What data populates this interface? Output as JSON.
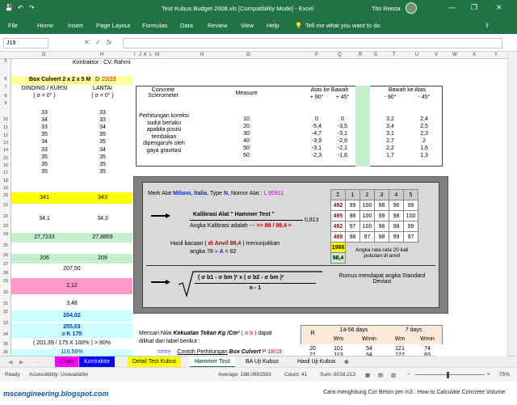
{
  "window": {
    "title": "Test Kubus Budget 2008.xls  [Compatibility Mode]  -  Excel",
    "user": "Tito Reista",
    "minimize": "—",
    "restore": "❐",
    "close": "✕"
  },
  "ribbon": {
    "tabs": [
      "File",
      "Home",
      "Insert",
      "Page Layout",
      "Formulas",
      "Data",
      "Review",
      "View",
      "Help"
    ],
    "tell_me": "Tell me what you want to do"
  },
  "formula_bar": {
    "name_box": "J19",
    "cancel": "✕",
    "enter": "✓",
    "fx": "fx",
    "value": ""
  },
  "columns": [
    "G",
    "H",
    "I",
    "J",
    "K",
    "L",
    "M",
    "N",
    "O",
    "P",
    "Q",
    "R",
    "S",
    "T",
    "U",
    "V",
    "W",
    "X",
    "Y"
  ],
  "rows": [
    "5",
    "6",
    "7",
    "8",
    "9",
    "10",
    "11",
    "12",
    "13",
    "14",
    "15",
    "16",
    "17",
    "18",
    "19",
    "20",
    "21",
    "22",
    "23",
    "24",
    "25",
    "26",
    "27",
    "28",
    "29",
    "30",
    "31",
    "32",
    "33",
    "34",
    "35",
    "36",
    "37",
    "38",
    "39"
  ],
  "left": {
    "kontraktor": "Kontraktor : CV. Rahmi",
    "box_label": "Box Culvert 2 x 2 x 5 M",
    "box_d": "D",
    "box_num": "22/23",
    "col1_header": "DINDING / KURSI",
    "col1_sub": "( σ = 0° )",
    "col2_header": "LANTAI",
    "col2_sub": "( σ = 0° )",
    "values_g": [
      "33",
      "34",
      "33",
      "35",
      "34",
      "33",
      "35",
      "35",
      "35"
    ],
    "values_h": [
      "33",
      "33",
      "34",
      "35",
      "35",
      "34",
      "35",
      "35",
      "35"
    ],
    "sum_g": "341",
    "sum_h": "343",
    "avg_g": "34,1",
    "avg_h": "34,3",
    "r24_g": "27,7233",
    "r24_h": "27,8859",
    "r27_g": "206",
    "r27_h": "209",
    "r28": "207,50",
    "r30": "2,12",
    "r32": "3,48",
    "r34": "204,02",
    "r35": "255,03",
    "r36": "≥ K 175",
    "r38": "( 201,39 / 175 X 100% ) > 80%",
    "r39": "116,58%"
  },
  "table_top": {
    "h_concrete": "Concrete Sclerometer",
    "h_measure": "Measure",
    "h_atas_bawah": "Atas ke Bawah",
    "h_bawah_atas": "Bawah ke Atas",
    "sub": [
      "+ 90°",
      "+ 45°",
      "- 90°",
      "- 45°"
    ],
    "note": "Perhitungan koreksi sudut berlaku apabila posisi tembakan dipengaruhi oleh gaya gravitasi",
    "rows": [
      [
        "10",
        "0",
        "0",
        "3,2",
        "2,4"
      ],
      [
        "20",
        "-5,4",
        "-3,5",
        "3,4",
        "2,5"
      ],
      [
        "30",
        "-4,7",
        "-3,1",
        "3,1",
        "2,3"
      ],
      [
        "40",
        "-3,9",
        "-2,6",
        "2,7",
        "2"
      ],
      [
        "50",
        "-3,1",
        "-2,1",
        "2,2",
        "1,6"
      ],
      [
        "60",
        "-2,3",
        "-1,6",
        "1,7",
        "1,3"
      ]
    ]
  },
  "panel": {
    "merk_prefix": "Merk Alat ",
    "merk_brand": "Milano, Italia",
    "merk_type_prefix": ", Type ",
    "merk_type": "N",
    "merk_nomor_prefix": ", Nomor Alat : ",
    "merk_nomor": "L 95911",
    "kalibrasi_title": "Kalibrasi Alat \" Hammer Test \"",
    "kalibrasi_text": "Angka Kalibrasi adalah ---",
    "kalibrasi_arrow": ">> 80 / 98,4 =",
    "kalibrasi_val": "0,813",
    "hasil_prefix": "Hasil bacaan (",
    "hasil_red": " di Anvil 98,4 ",
    "hasil_suffix": ") menunjukkan",
    "angka_text": "angka 78 »",
    "angka_a": "A",
    "angka_rest": "< 82",
    "formula_num": "( σ b1 - σ bm )² x ( σ b2 - σ bm )²",
    "formula_den": "n - 1",
    "rumus": "Rumus mendapat angka Standard Deviasi",
    "mini_head": [
      "Σ",
      "1",
      "2",
      "3",
      "4",
      "5"
    ],
    "mini_rows": [
      [
        "492",
        "99",
        "100",
        "98",
        "96",
        "99"
      ],
      [
        "495",
        "98",
        "100",
        "99",
        "98",
        "100"
      ],
      [
        "492",
        "97",
        "100",
        "98",
        "98",
        "99"
      ],
      [
        "489",
        "98",
        "97",
        "98",
        "99",
        "97"
      ]
    ],
    "mini_1968": "1968",
    "mini_984": "98,4",
    "mini_note": "Angka rata-rata 20 kali pukulan di anvil"
  },
  "bottom": {
    "mencari_prefix": "Mencari Nilai",
    "mencari_bold": " Kekuatan Tekan Kg /Cm² ",
    "mencari_red": "( σ b )",
    "mencari_suffix": " dapat",
    "dilihat": "dilihat dari tabel berikut :",
    "arrow": "===>",
    "contoh_prefix": "Contoh Perhitungan",
    "contoh_bold": " Box Culvert",
    "contoh_red": " P 18/19",
    "r_head": "R",
    "d1428": "14-56 days",
    "d7": "7 days",
    "wm": "Wm",
    "wmin": "Wmin",
    "row20": [
      "20",
      "101",
      "54",
      "121",
      "74"
    ],
    "row21": [
      "21",
      "113",
      "64",
      "122",
      "83"
    ]
  },
  "sheet_tabs": [
    "Chart",
    "Kontraktor",
    "Detail Test Kubus",
    "Hammer Test",
    "BA Uji Kubus",
    "Hasil Uji Kubus"
  ],
  "status": {
    "ready": "Ready",
    "accessibility": "Accessibility: Unavailable",
    "average": "Average: 188,0691563",
    "count": "Count: 41",
    "sum": "Sum: 6018,213",
    "zoom": "75%"
  },
  "footer": {
    "brand": "mscengineering.blogspot.com",
    "caption": "Cara menghitung Cor Beton per m3 : How to Calculate Concrete Volume"
  }
}
